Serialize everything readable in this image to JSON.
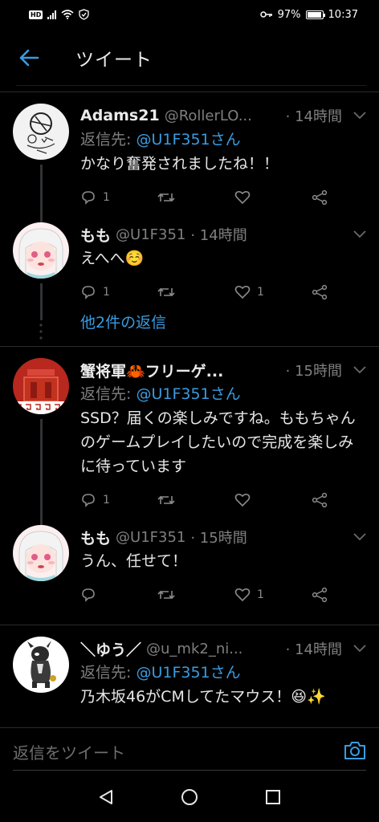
{
  "status_bar": {
    "hd": "HD",
    "battery": "97%",
    "battery_level": 0.97,
    "time": "10:37"
  },
  "header": {
    "title": "ツイート"
  },
  "tweets": [
    {
      "name": "Adams21",
      "handle": "@RollerLO...",
      "time": "· 14時間",
      "reply_prefix": "返信先: ",
      "reply_mention": "@U1F351さん",
      "text": "かなり奮発されましたね！！",
      "reply_count": "1",
      "retweet_count": "",
      "like_count": ""
    },
    {
      "name": "もも",
      "handle": "@U1F351",
      "time": "· 14時間",
      "text": "えへへ☺️",
      "reply_count": "1",
      "retweet_count": "",
      "like_count": "1"
    },
    {
      "more_replies": "他2件の返信"
    },
    {
      "name": "蟹将軍🦀フリーゲ...",
      "handle": "",
      "time": "· 15時間",
      "reply_prefix": "返信先: ",
      "reply_mention": "@U1F351さん",
      "text": "SSD？届くの楽しみですね。ももちゃんのゲームプレイしたいので完成を楽しみに待っています",
      "reply_count": "1",
      "retweet_count": "",
      "like_count": ""
    },
    {
      "name": "もも",
      "handle": "@U1F351",
      "time": "· 15時間",
      "text": "うん、任せて！",
      "reply_count": "",
      "retweet_count": "",
      "like_count": "1"
    },
    {
      "name": "＼ゆう／",
      "handle": "@u_mk2_ni...",
      "time": "· 14時間",
      "reply_prefix": "返信先: ",
      "reply_mention": "@U1F351さん",
      "text": "乃木坂46がCMしてたマウス！😆✨"
    }
  ],
  "compose": {
    "placeholder": "返信をツイート"
  },
  "colors": {
    "accent": "#3a9be0",
    "background": "#000000",
    "muted": "#7f7f7f"
  },
  "icons": {
    "back": "arrow-left-icon",
    "reply": "comment-icon",
    "retweet": "retweet-icon",
    "like": "heart-icon",
    "share": "share-icon",
    "camera": "camera-icon"
  }
}
